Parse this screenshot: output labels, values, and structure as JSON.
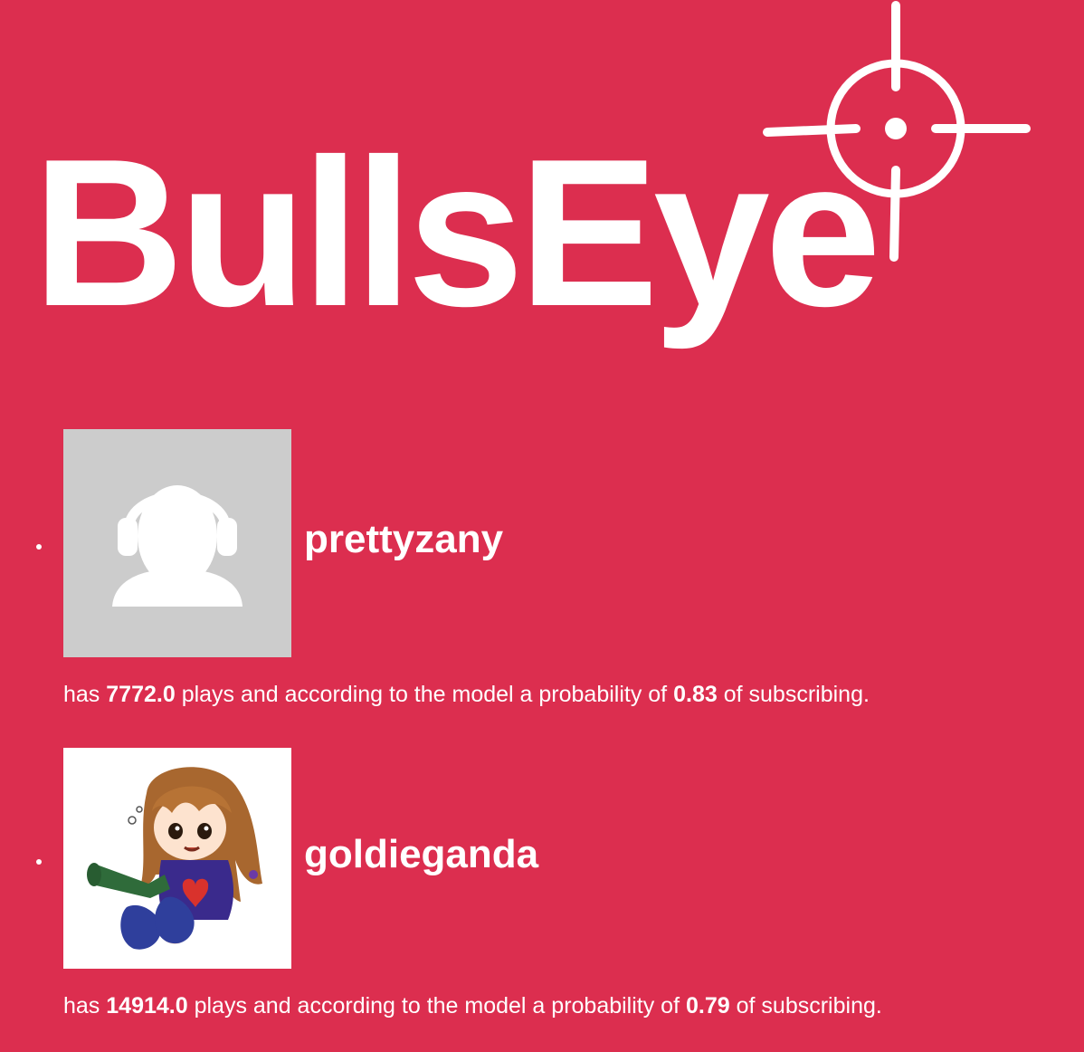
{
  "app": {
    "logo_text": "BullsEye",
    "logo_icon": "crosshair-icon"
  },
  "users": [
    {
      "username": "prettyzany",
      "avatar": "default-user-headphones-icon",
      "stats_prefix": "has",
      "plays": "7772.0",
      "stats_middle": "plays and according to the model a probability of",
      "probability": "0.83",
      "stats_suffix": "of subscribing."
    },
    {
      "username": "goldieganda",
      "avatar": "anime-girl-avatar-image",
      "stats_prefix": "has",
      "plays": "14914.0",
      "stats_middle": "plays and according to the model a probability of",
      "probability": "0.79",
      "stats_suffix": "of subscribing."
    }
  ],
  "colors": {
    "background": "#dc2e4f",
    "text": "#ffffff",
    "avatar_placeholder": "#cccccc"
  }
}
